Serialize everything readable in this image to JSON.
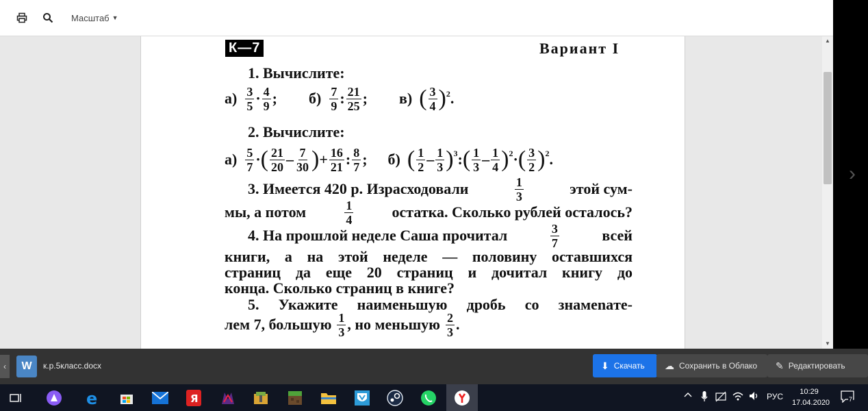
{
  "viewer": {
    "zoom_label": "Масштаб",
    "icons": {
      "print": "printer-icon",
      "search": "search-icon",
      "next": "chevron-right-icon"
    }
  },
  "document": {
    "tag": "К—7",
    "variant": "Вариант I",
    "task1": {
      "heading": "1. Вычислите:",
      "a_label": "а)",
      "a_n1": "3",
      "a_d1": "5",
      "a_op": "·",
      "a_n2": "4",
      "a_d2": "9",
      "a_end": ";",
      "b_label": "б)",
      "b_n1": "7",
      "b_d1": "9",
      "b_op": ":",
      "b_n2": "21",
      "b_d2": "25",
      "b_end": ";",
      "c_label": "в)",
      "c_n": "3",
      "c_d": "4",
      "c_pow": "2",
      "c_end": "."
    },
    "task2": {
      "heading": "2. Вычислите:",
      "a_label": "а)",
      "a_f1n": "5",
      "a_f1d": "7",
      "a_f2n": "21",
      "a_f2d": "20",
      "a_f3n": "7",
      "a_f3d": "30",
      "a_f4n": "16",
      "a_f4d": "21",
      "a_f5n": "8",
      "a_f5d": "7",
      "b_label": "б)",
      "b_f1n": "1",
      "b_f1d": "2",
      "b_f2n": "1",
      "b_f2d": "3",
      "b_p1": "3",
      "b_f3n": "1",
      "b_f3d": "3",
      "b_f4n": "1",
      "b_f4d": "4",
      "b_p2": "2",
      "b_f5n": "3",
      "b_f5d": "2",
      "b_p3": "2"
    },
    "task3": {
      "l1a": "3. Имеется 420 р. Израсходовали",
      "f1n": "1",
      "f1d": "3",
      "l1b": "этой сум-",
      "l2a": "мы, а потом",
      "f2n": "1",
      "f2d": "4",
      "l2b": "остатка. Сколько рублей осталось?"
    },
    "task4": {
      "l1a": "4. На прошлой неделе Саша прочитал",
      "fn": "3",
      "fd": "7",
      "l1b": "всей",
      "l2": "книги, а на этой неделе — половину оставшихся",
      "l3": "страниц да еще 20 страниц и дочитал книгу до",
      "l4": "конца. Сколько страниц в книге?"
    },
    "task5": {
      "l1": "5. Укажите наименьшую дробь со знамenaте-",
      "l2a": "лем 7, большую",
      "f1n": "1",
      "f1d": "3",
      "l2b": ", но меньшую",
      "f2n": "2",
      "f2d": "3",
      "l2c": "."
    }
  },
  "download_bar": {
    "file_name": "к.р.5класс.docx",
    "file_icon_letter": "W",
    "download_label": "Скачать",
    "cloud_label": "Сохранить в Облако",
    "edit_label": "Редактировать"
  },
  "taskbar": {
    "language": "РУС",
    "time": "10:29",
    "date": "17.04.2020",
    "notifications": "7"
  }
}
